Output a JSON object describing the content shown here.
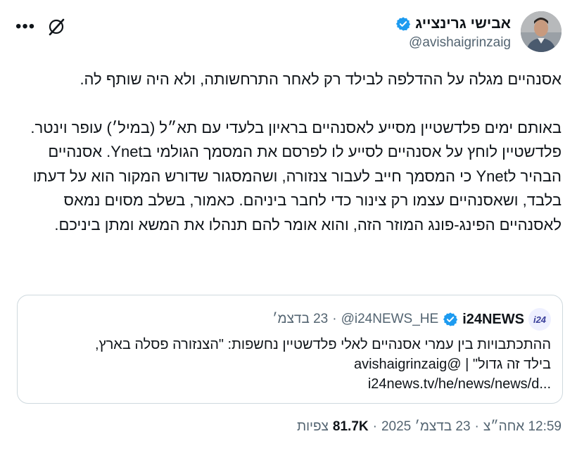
{
  "author": {
    "name": "אבישי גרינצייג",
    "handle": "@avishaigrinzaig"
  },
  "body": {
    "paragraph1": "אסנהיים מגלה על ההדלפה לבילד רק לאחר התרחשותה, ולא היה שותף לה.",
    "paragraph2": "באותם ימים פלדשטיין מסייע לאסנהיים בראיון בלעדי עם תא״ל (במיל׳) עופר וינטר. פלדשטיין לוחץ על אסנהיים לסייע לו לפרסם את המסמך הגולמי בYnet. אסנהיים הבהיר לYnet כי המסמך חייב לעבור צנזורה, ושהמסגור שדורש המקור הוא על דעתו בלבד, ושאסנהיים עצמו רק צינור כדי לחבר ביניהם. כאמור, בשלב מסוים נמאס לאסנהיים הפינג-פונג המוזר הזה, והוא אומר להם תנהלו את המשא ומתן ביניכם."
  },
  "quote": {
    "avatar_text": "i24",
    "name": "i24NEWS",
    "handle": "@i24NEWS_HE",
    "separator": "·",
    "date": "23 בדצמ׳",
    "line1": "ההתכתבויות בין עמרי אסנהיים לאלי פלדשטיין נחשפות: \"הצנזורה פסלה בארץ,",
    "line2": "בילד זה גדול\" | @avishaigrinzaig",
    "line3": "i24news.tv/he/news/news/d..."
  },
  "footer": {
    "time": "12:59 אחה״צ",
    "separator": "·",
    "date": "23 בדצמ׳ 2025",
    "separator2": "·",
    "views_count": "81.7K",
    "views_label": "צפיות"
  },
  "colors": {
    "verified": "#1d9bf0",
    "text_primary": "#0f1419",
    "text_secondary": "#536471",
    "border": "#cfd9de"
  },
  "icons": {
    "more": "more-horizontal-icon",
    "grok": "grok-icon",
    "verified": "verified-badge-icon"
  }
}
